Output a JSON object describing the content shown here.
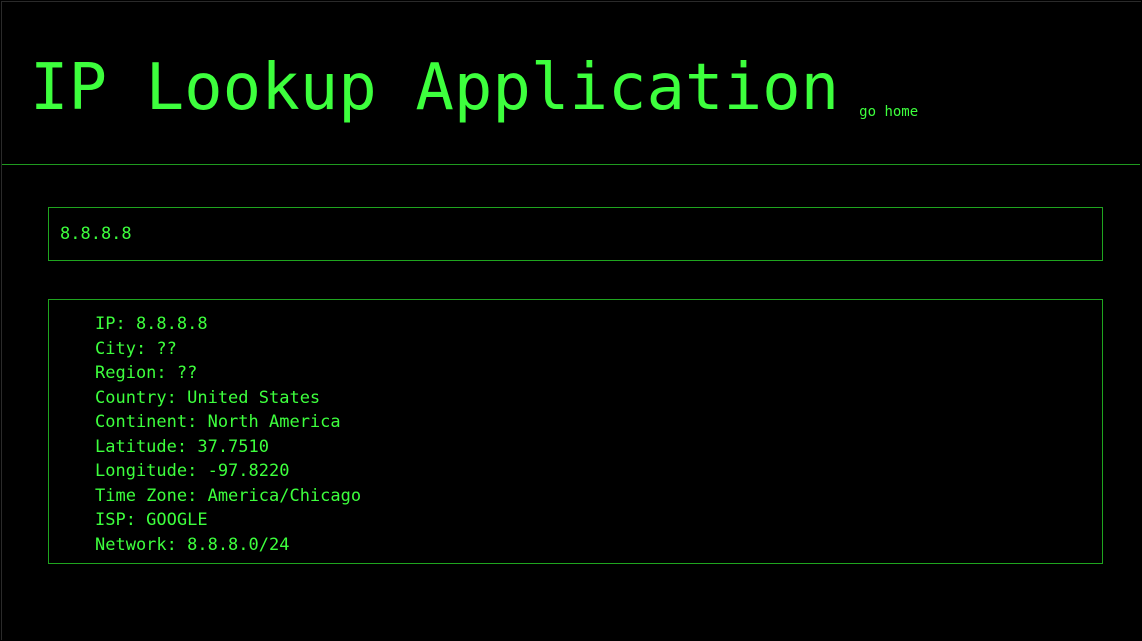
{
  "header": {
    "title": "IP Lookup Application",
    "home_link": "go home"
  },
  "search": {
    "value": "8.8.8.8"
  },
  "result": {
    "items": [
      "IP: 8.8.8.8",
      "City: ??",
      "Region: ??",
      "Country: United States",
      "Continent: North America",
      "Latitude: 37.7510",
      "Longitude: -97.8220",
      "Time Zone: America/Chicago",
      "ISP: GOOGLE",
      "Network: 8.8.8.0/24"
    ]
  },
  "colors": {
    "background": "#000000",
    "text": "#3dff3d",
    "border": "#1fa51f"
  }
}
